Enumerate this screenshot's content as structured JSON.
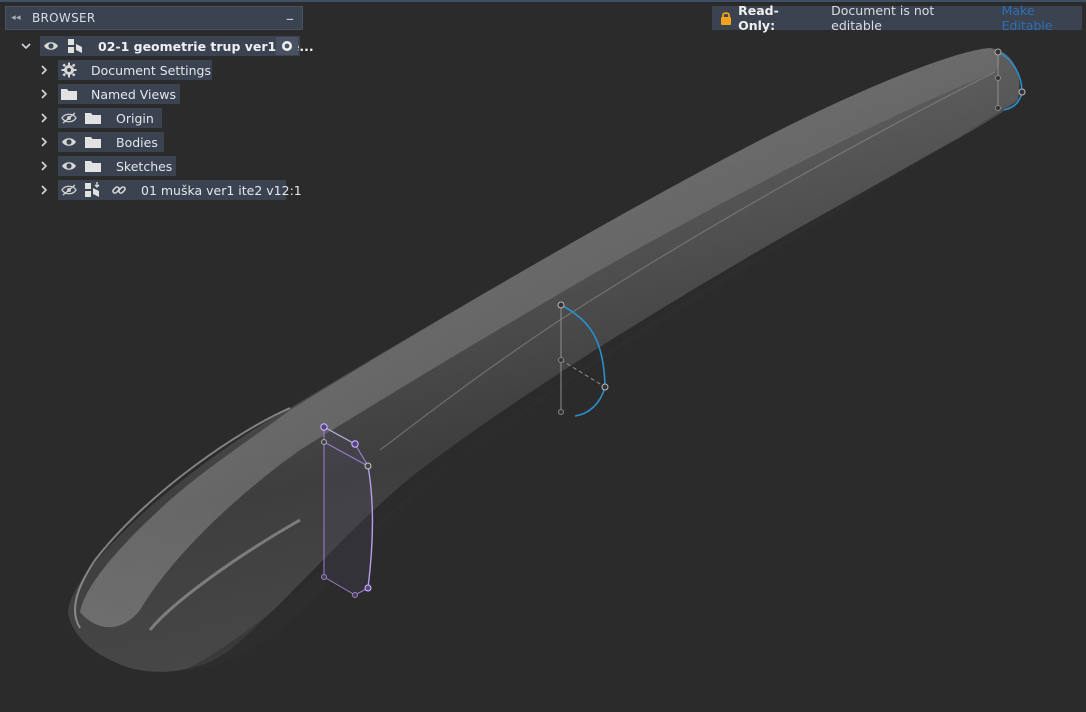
{
  "browser": {
    "title": "BROWSER",
    "root": {
      "label": "02-1 geometrie trup ver1 ite...",
      "items": [
        {
          "label": "Document Settings"
        },
        {
          "label": "Named Views"
        },
        {
          "label": "Origin"
        },
        {
          "label": "Bodies"
        },
        {
          "label": "Sketches"
        },
        {
          "label": "01 muška ver1 ite2 v12:1"
        }
      ]
    }
  },
  "readonly_bar": {
    "label": "Read-Only:",
    "message": "Document is not editable",
    "action": "Make Editable"
  },
  "colors": {
    "background": "#2b2b2b",
    "panel": "#3b4250",
    "accent_link": "#2f6fb3",
    "lock": "#f2a21b",
    "sketch_purple": "#9a7fd1",
    "sketch_blue": "#2a8fcf"
  }
}
